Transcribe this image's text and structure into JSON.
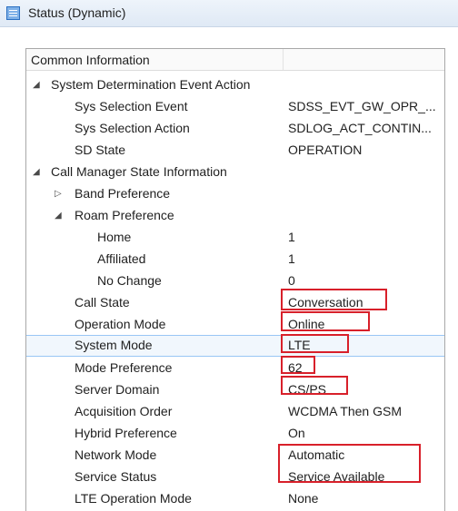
{
  "window": {
    "title": "Status (Dynamic)"
  },
  "table": {
    "column_header": "Common Information",
    "sections": [
      {
        "label": "System Determination Event Action",
        "rows": [
          {
            "name": "Sys Selection Event",
            "value": "SDSS_EVT_GW_OPR_..."
          },
          {
            "name": "Sys Selection Action",
            "value": "SDLOG_ACT_CONTIN..."
          },
          {
            "name": "SD State",
            "value": "OPERATION"
          }
        ]
      },
      {
        "label": "Call Manager State Information",
        "band_preference": "Band Preference",
        "roam_preference": {
          "label": "Roam Preference",
          "rows": [
            {
              "name": "Home",
              "value": "1"
            },
            {
              "name": "Affiliated",
              "value": "1"
            },
            {
              "name": "No Change",
              "value": "0"
            }
          ]
        },
        "rows": [
          {
            "name": "Call State",
            "value": "Conversation"
          },
          {
            "name": "Operation Mode",
            "value": "Online"
          },
          {
            "name": "System Mode",
            "value": "LTE"
          },
          {
            "name": "Mode Preference",
            "value": "62"
          },
          {
            "name": "Server Domain",
            "value": "CS/PS"
          },
          {
            "name": "Acquisition Order",
            "value": "WCDMA Then GSM"
          },
          {
            "name": "Hybrid Preference",
            "value": "On"
          },
          {
            "name": "Network Mode",
            "value": "Automatic"
          },
          {
            "name": "Service Status",
            "value": "Service Available"
          },
          {
            "name": "LTE Operation Mode",
            "value": "None"
          }
        ]
      }
    ]
  },
  "highlight_color": "#d8202a",
  "selection_color": "#99c6f5",
  "icons": {
    "expanded": "expanded-triangle-icon",
    "collapsed": "collapsed-triangle-icon",
    "window": "window-icon"
  }
}
